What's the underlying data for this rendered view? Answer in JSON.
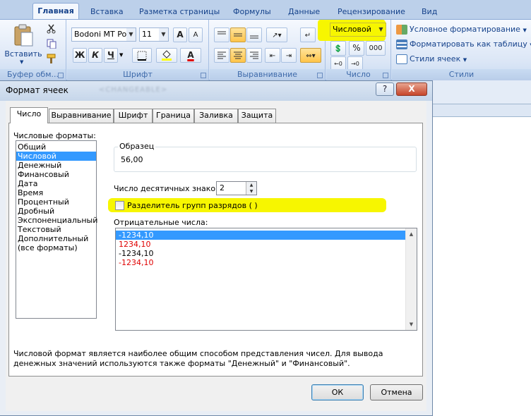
{
  "ribbon": {
    "tabs": [
      "Главная",
      "Вставка",
      "Разметка страницы",
      "Формулы",
      "Данные",
      "Рецензирование",
      "Вид"
    ],
    "clipboard": {
      "paste_label": "Вставить",
      "group_label": "Буфер обм..."
    },
    "font": {
      "name": "Bodoni MT Posl",
      "size": "11",
      "bold": "Ж",
      "italic": "К",
      "underline": "Ч",
      "grow": "A",
      "shrink": "A",
      "font_color": "A",
      "group_label": "Шрифт"
    },
    "alignment": {
      "group_label": "Выравнивание"
    },
    "number": {
      "format": "Числовой",
      "percent": "%",
      "thousands": "000",
      "group_label": "Число"
    },
    "styles": {
      "conditional": "Условное форматирование",
      "as_table": "Форматировать как таблицу",
      "cell_styles": "Стили ячеек",
      "group_label": "Стили"
    }
  },
  "dialog": {
    "title": "Формат ячеек",
    "blurred_text": "<CHANGEABLE>",
    "help": "?",
    "close": "X",
    "tabs": [
      "Число",
      "Выравнивание",
      "Шрифт",
      "Граница",
      "Заливка",
      "Защита"
    ],
    "formats_label": "Числовые форматы:",
    "formats": [
      "Общий",
      "Числовой",
      "Денежный",
      "Финансовый",
      "Дата",
      "Время",
      "Процентный",
      "Дробный",
      "Экспоненциальный",
      "Текстовый",
      "Дополнительный",
      "(все форматы)"
    ],
    "selected_format": 1,
    "sample_label": "Образец",
    "sample_value": "56,00",
    "decimals_label": "Число десятичных знаков:",
    "decimals_value": "2",
    "separator_label": "Разделитель групп разрядов ( )",
    "negative_label": "Отрицательные числа:",
    "negative_options": [
      {
        "text": "-1234,10",
        "color": "#000000",
        "selected": true
      },
      {
        "text": "1234,10",
        "color": "#e00000",
        "selected": false
      },
      {
        "text": "-1234,10",
        "color": "#000000",
        "selected": false
      },
      {
        "text": "-1234,10",
        "color": "#e00000",
        "selected": false
      }
    ],
    "description": "Числовой формат является наиболее общим способом представления чисел. Для вывода денежных значений используются также форматы \"Денежный\" и \"Финансовый\".",
    "ok": "ОК",
    "cancel": "Отмена"
  },
  "colors": {
    "highlight": "#f7f600",
    "selection": "#3399ff",
    "negative_red": "#e00000"
  }
}
